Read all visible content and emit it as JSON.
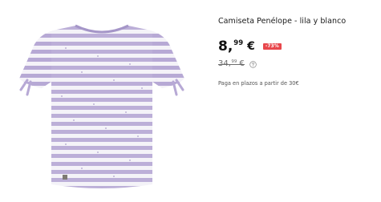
{
  "product": {
    "title": "Camiseta Penélope - lila y blanco",
    "price": {
      "integer": "8,",
      "cents": "99",
      "currency": "€"
    },
    "discount": "-73%",
    "old_price": {
      "integer": "34,",
      "cents": "99",
      "currency": "€"
    },
    "installments_text": "Paga en plazos a partir de 30€",
    "icons": {
      "info": "info-circle-icon"
    },
    "colors": {
      "badge": "#e8474c",
      "shirt_lilac": "#b5a6d3",
      "shirt_white": "#f5f3f8"
    }
  }
}
